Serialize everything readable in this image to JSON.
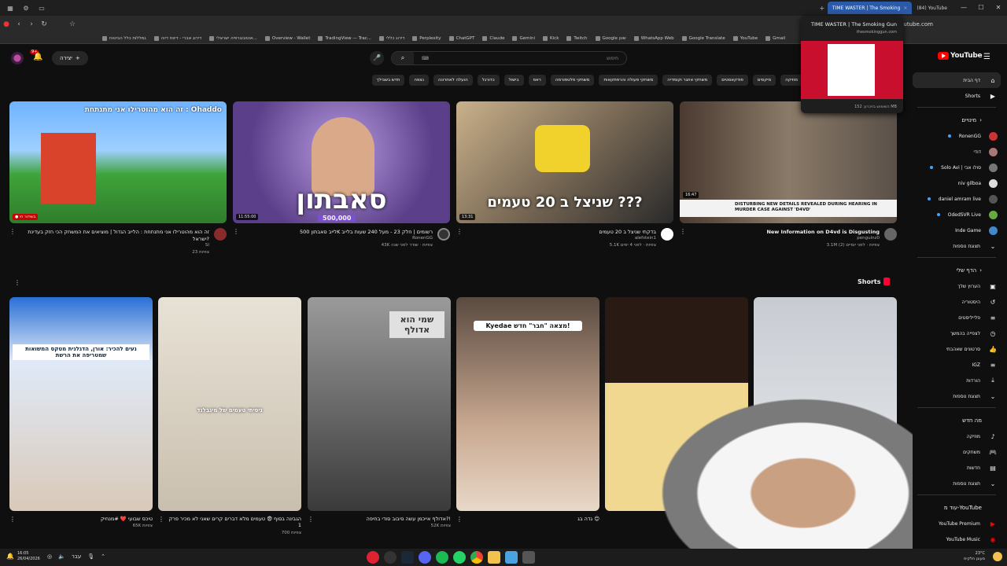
{
  "browser": {
    "tabs": [
      {
        "label": "TIME WASTER | The Smoking",
        "active": true
      },
      {
        "label": "(84) YouTube",
        "active": false
      }
    ],
    "url": "youtube.com",
    "bookmarks": [
      "Kick",
      "Twitch",
      "Google שונן",
      "WhatsApp Web",
      "Google Translate",
      "YouTube",
      "Gmail",
      "Perplexity",
      "ChatGPT",
      "Claude",
      "Gemini",
      "Overview - Wallet",
      "TradingView — Trac...",
      "דירוג כללי",
      "אוטובוגרפיה ישראלי...",
      "דירוג אברי - דיווח דיוה",
      "גמללות כלל הביטוח"
    ],
    "preview": {
      "title": "TIME WASTER | The Smoking Gun",
      "url": "thesmokinggun.com",
      "memory": "השימוש בזיכרון: 152 MB"
    }
  },
  "youtube": {
    "logo": "YouTube",
    "create_label": "יצירה",
    "notif_count": "9+",
    "search_placeholder": "חיפוש",
    "chips": [
      "הכול",
      "מוזיקה",
      "מיקסים",
      "פודקאסטים",
      "משחקי אתגר וקומדיה",
      "משחקי פעולה והרפתקאות",
      "משחקי פלטפורמה",
      "ראפ",
      "בישול",
      "כדורגל",
      "הועלה לאחרונה",
      "נצפה",
      "חדש בשבילך"
    ],
    "videos": [
      {
        "title": "זה הוא מהוטרילו אני מתנתחת : הלייב הגדול | מוציאים את המשחק הכי חזק בעדינת ישראל?",
        "channel": "SI",
        "stats": "23 צפיות",
        "duration": "",
        "label": "● בשידור חי"
      },
      {
        "title": "לייב סאבתון 500K רשומים | חלק 23 - מעל 240 שעות בלייב",
        "channel": "RonenGG",
        "stats": "43K צפיות · שודר לפני שנה",
        "duration": "11:55:00",
        "label": "500,000"
      },
      {
        "title": "בדקתי שניצל ב 20 טעמים",
        "channel": "alefstein1",
        "stats": "5.1K צפיות · לפני 4 ימים",
        "duration": "13:31",
        "label": "שניצל ב 20 טעמים ???"
      },
      {
        "title": "New Information on D4vd is Disgusting",
        "channel": "penguinz0",
        "stats": "3.1M צפיות · לפני יומיים (2)",
        "duration": "16:47",
        "label": "DISTURBING NEW DETAILS REVEALED DURING HEARING IN MURDER CASE AGAINST 'D4VD'"
      }
    ],
    "shorts_header": "Shorts",
    "shorts": [
      {
        "title": "טיכס שבועי ❤️ #מנחיק",
        "views": "65K צפיות",
        "caption": "נעים להכיר: אורן, הדגלנית מטקס המשואות שמטריפה את הרשת"
      },
      {
        "title": "הגבינה בסוף 😨 טעמים מלא דברים קרים שאני לא מכיר פרק 1",
        "views": "700 צפיות",
        "caption": "ניסיתי טעמים של מינבלנד"
      },
      {
        "title": "אדולף אייכמן עשה סיבוב סודי בחיפה?!",
        "views": "52K צפיות",
        "caption": "שמי הוא אדולף"
      },
      {
        "title": "גדה בג 😊",
        "views": "",
        "caption": "Kyedae מצאה \"חבר\" חדש!"
      },
      {
        "title": "",
        "views": "",
        "caption": ""
      },
      {
        "title": "",
        "views": "",
        "caption": ""
      }
    ]
  },
  "sidebar": {
    "home": "דף הבית",
    "shorts": "Shorts",
    "subs_header": "מינויים",
    "subs": [
      "RonenGG",
      "דודי",
      "Solo Avi | סולו אבי",
      "niv gilboa",
      "daniel amram live",
      "OdedSVR Live",
      "Inde Game"
    ],
    "show_more": "תצוגת נוספות",
    "you_header": "הדף שלי",
    "you_items": [
      "הערוץ שלך",
      "היסטוריה",
      "פלייליסטים",
      "לצפייה בהמשך",
      "סרטונים שאהבתי",
      "IGZ",
      "הורדות"
    ],
    "explore_header": "מה חדש",
    "explore_items": [
      "מוזיקה",
      "משחקים",
      "חדשות"
    ],
    "more_header": "עוד מ-YouTube",
    "more_items": [
      "YouTube Premium",
      "YouTube Music"
    ]
  },
  "taskbar": {
    "time": "16:05",
    "date": "26/04/2026",
    "lang": "עבר",
    "temp": "23°C",
    "weather": "מעונן חלקית"
  },
  "colors": {
    "accent": "#ff0000",
    "bg": "#0f0f0f",
    "chip": "#272727",
    "tab_active": "#2b5aa8"
  }
}
